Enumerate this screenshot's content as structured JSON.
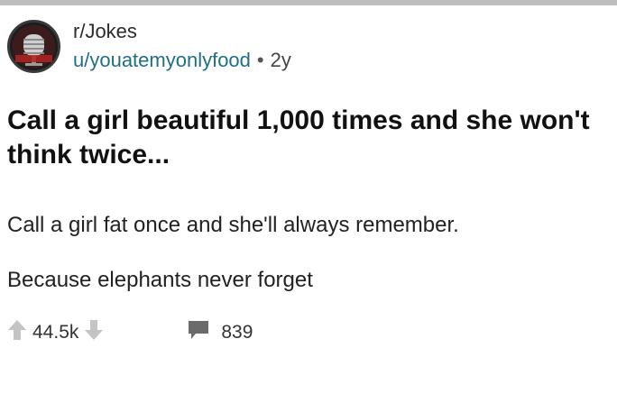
{
  "post": {
    "subreddit": "r/Jokes",
    "username": "u/youatemyonlyfood",
    "separator": "•",
    "age": "2y",
    "title": "Call a girl beautiful 1,000 times and she won't think twice...",
    "body_line1": "Call a girl fat once and she'll always remember.",
    "body_line2": "Because elephants never forget",
    "score": "44.5k",
    "comment_count": "839"
  },
  "icons": {
    "avatar": "subreddit-avatar-icon",
    "upvote": "upvote-arrow-icon",
    "downvote": "downvote-arrow-icon",
    "comment": "comment-bubble-icon"
  },
  "colors": {
    "username": "#1f6f88",
    "vote_icon": "#bdbdbd",
    "comment_icon": "#6b6b6b",
    "top_border": "#bdbdbd"
  }
}
